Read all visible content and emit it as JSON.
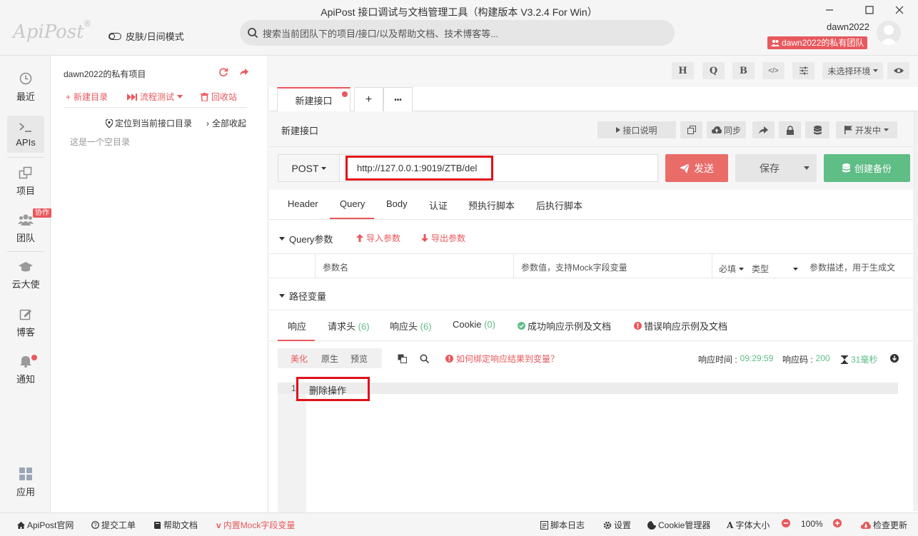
{
  "window": {
    "title": "ApiPost 接口调试与文档管理工具（构建版本 V3.2.4 For Win）"
  },
  "brand": {
    "logo": "ApiPost",
    "reg": "®"
  },
  "header": {
    "theme_label": "皮肤/日间模式",
    "search_placeholder": "搜索当前团队下的项目/接口/以及帮助文档、技术博客等...",
    "username": "dawn2022",
    "team_badge": "dawn2022的私有团队"
  },
  "leftnav": {
    "items": [
      {
        "label": "最近",
        "icon": "clock-icon"
      },
      {
        "label": "APIs",
        "icon": "terminal-icon"
      },
      {
        "label": "项目",
        "icon": "project-icon"
      },
      {
        "label": "团队",
        "icon": "team-icon"
      },
      {
        "label": "云大使",
        "icon": "mortarboard-icon"
      },
      {
        "label": "博客",
        "icon": "edit-icon"
      },
      {
        "label": "通知",
        "icon": "bell-icon"
      },
      {
        "label": "应用",
        "icon": "apps-icon"
      }
    ],
    "collab_badge": "协作"
  },
  "project": {
    "title": "dawn2022的私有项目",
    "new_dir": "新建目录",
    "flow_test": "流程测试",
    "recycle": "回收站",
    "locate": "定位到当前接口目录",
    "collapse_all": "全部收起",
    "empty": "这是一个空目录"
  },
  "toolbar": {
    "h": "H",
    "q": "Q",
    "b": "B",
    "code": "</>",
    "env_select": "未选择环境"
  },
  "tabs": {
    "active": "新建接口",
    "add": "+",
    "more": "•••"
  },
  "api": {
    "name": "新建接口",
    "doc_btn": "接口说明",
    "sync_btn": "同步",
    "status_btn": "开发中"
  },
  "request": {
    "method": "POST",
    "url": "http://127.0.0.1:9019/ZTB/del",
    "send": "发送",
    "save": "保存",
    "backup": "创建备份"
  },
  "req_tabs": [
    "Header",
    "Query",
    "Body",
    "认证",
    "预执行脚本",
    "后执行脚本"
  ],
  "query": {
    "section_label": "Query参数",
    "import": "导入参数",
    "export": "导出参数",
    "col_name": "参数名",
    "col_value": "参数值，支持Mock字段变量",
    "col_required": "必填",
    "col_type": "类型",
    "col_desc": "参数描述，用于生成文"
  },
  "path_vars": {
    "label": "路径变量"
  },
  "resp_tabs": {
    "resp": "响应",
    "req_headers": "请求头",
    "req_headers_count": "(6)",
    "resp_headers": "响应头",
    "resp_headers_count": "(6)",
    "cookie": "Cookie",
    "cookie_count": "(0)",
    "success_example": "成功响应示例及文档",
    "error_example": "错误响应示例及文档"
  },
  "response": {
    "view_pretty": "美化",
    "view_raw": "原生",
    "view_preview": "预览",
    "bind_help": "如何绑定响应结果到变量？",
    "time_label": "响应时间 :",
    "time_value": "09:29:59",
    "code_label": "响应码 :",
    "code_value": "200",
    "duration": "31毫秒",
    "line_number": "1",
    "body": "删除操作"
  },
  "footer": {
    "site": "ApiPost官网",
    "ticket": "提交工单",
    "help": "帮助文档",
    "mock": "内置Mock字段变量",
    "script_log": "脚本日志",
    "settings": "设置",
    "cookie_mgr": "Cookie管理器",
    "font_size": "字体大小",
    "zoom": "100%",
    "update": "检查更新"
  },
  "colors": {
    "accent": "#e8585c",
    "success": "#5fbd86",
    "send": "#ea6c68"
  }
}
